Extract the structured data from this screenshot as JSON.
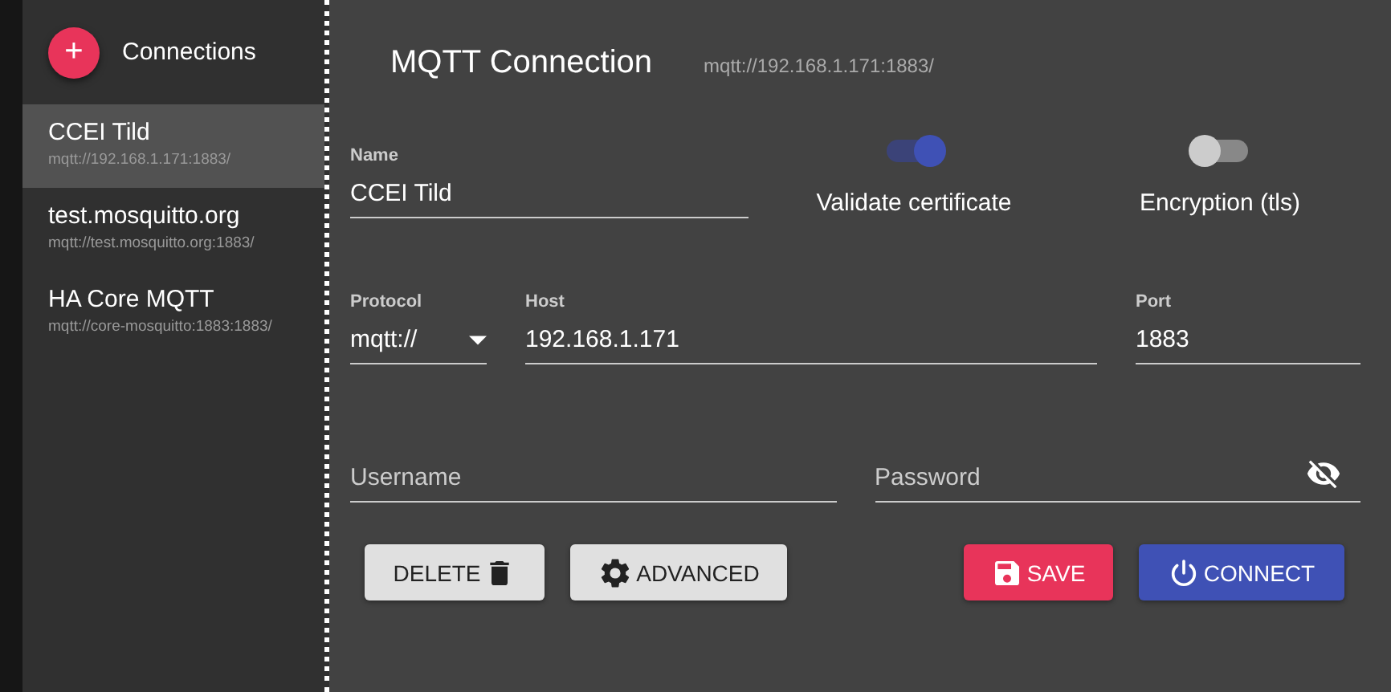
{
  "sidebar": {
    "add_label": "+",
    "title": "Connections",
    "items": [
      {
        "name": "CCEI Tild",
        "url": "mqtt://192.168.1.171:1883/",
        "selected": true
      },
      {
        "name": "test.mosquitto.org",
        "url": "mqtt://test.mosquitto.org:1883/",
        "selected": false
      },
      {
        "name": "HA Core MQTT",
        "url": "mqtt://core-mosquitto:1883:1883/",
        "selected": false
      }
    ]
  },
  "header": {
    "title": "MQTT Connection",
    "url": "mqtt://192.168.1.171:1883/"
  },
  "name_field": {
    "label": "Name",
    "value": "CCEI Tild"
  },
  "toggles": [
    {
      "label": "Validate certificate",
      "on": true
    },
    {
      "label": "Encryption (tls)",
      "on": false
    }
  ],
  "protocol": {
    "label": "Protocol",
    "value": "mqtt://"
  },
  "host": {
    "label": "Host",
    "value": "192.168.1.171"
  },
  "port": {
    "label": "Port",
    "value": "1883"
  },
  "username": {
    "placeholder": "Username"
  },
  "password": {
    "placeholder": "Password"
  },
  "buttons": [
    {
      "label": "DELETE",
      "kind": "delete"
    },
    {
      "label": "ADVANCED",
      "kind": "advanced"
    },
    {
      "label": "SAVE",
      "kind": "save"
    },
    {
      "label": "CONNECT",
      "kind": "connect"
    }
  ]
}
